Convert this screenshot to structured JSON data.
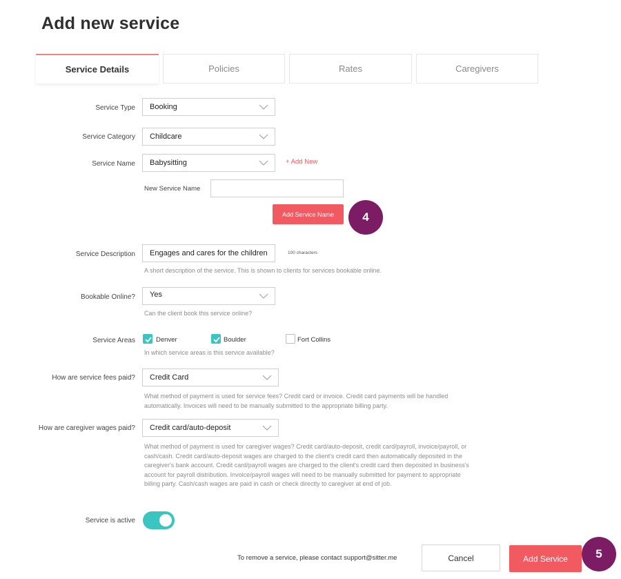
{
  "header": {
    "title": "Add new service"
  },
  "tabs": [
    {
      "label": "Service Details",
      "active": true
    },
    {
      "label": "Policies",
      "active": false
    },
    {
      "label": "Rates",
      "active": false
    },
    {
      "label": "Caregivers",
      "active": false
    }
  ],
  "form": {
    "service_type": {
      "label": "Service Type",
      "value": "Booking"
    },
    "service_category": {
      "label": "Service Category",
      "value": "Childcare"
    },
    "service_name": {
      "label": "Service Name",
      "value": "Babysitting",
      "add_new": "+ Add New"
    },
    "new_service_name": {
      "label": "New Service Name",
      "value": "",
      "button": "Add Service Name"
    },
    "service_description": {
      "label": "Service Description",
      "value": "Engages and cares for the children",
      "counter": "100 characters",
      "helper": "A short description of the service. This is shown to clients for services bookable online."
    },
    "bookable_online": {
      "label": "Bookable Online?",
      "value": "Yes",
      "helper": "Can the client book this service online?"
    },
    "service_areas": {
      "label": "Service Areas",
      "options": [
        {
          "label": "Denver",
          "checked": true
        },
        {
          "label": "Boulder",
          "checked": true
        },
        {
          "label": "Fort Collins",
          "checked": false
        }
      ],
      "helper": "In which service areas is this service available?"
    },
    "service_fees": {
      "label": "How are service fees paid?",
      "value": "Credit Card",
      "helper_lines": [
        "What method of payment is used for service fees? Credit card or invoice. Credit card payments will be handled",
        "automatically. Invoices will need to be manually submitted to the appropriate billing party."
      ]
    },
    "caregiver_wages": {
      "label": "How are caregiver wages paid?",
      "value": "Credit card/auto-deposit",
      "helper_lines": [
        "What method of payment is used for caregiver wages? Credit card/auto-deposit, credit card/payroll, invoice/payroll, or",
        "cash/cash. Credit card/auto-deposit wages are charged to the client's credit card then automatically deposited in the",
        "caregiver's bank account. Credit card/payroll wages are charged to the client's credit card then deposited in business's",
        "account for payroll distribution. Invoice/payroll wages will need to be manually submitted for payment to appropriate",
        "billing party. Cash/cash wages are paid in cash or check directly to caregiver at end of job."
      ]
    },
    "active": {
      "label": "Service is active",
      "on": true
    }
  },
  "footer": {
    "note": "To remove a service, please contact support@sitter.me",
    "cancel": "Cancel",
    "submit": "Add Service"
  },
  "badges": {
    "step4": "4",
    "step5": "5"
  },
  "colors": {
    "accent": "#f15a60",
    "teal": "#3cc5c0",
    "badge": "#7b1c64"
  }
}
